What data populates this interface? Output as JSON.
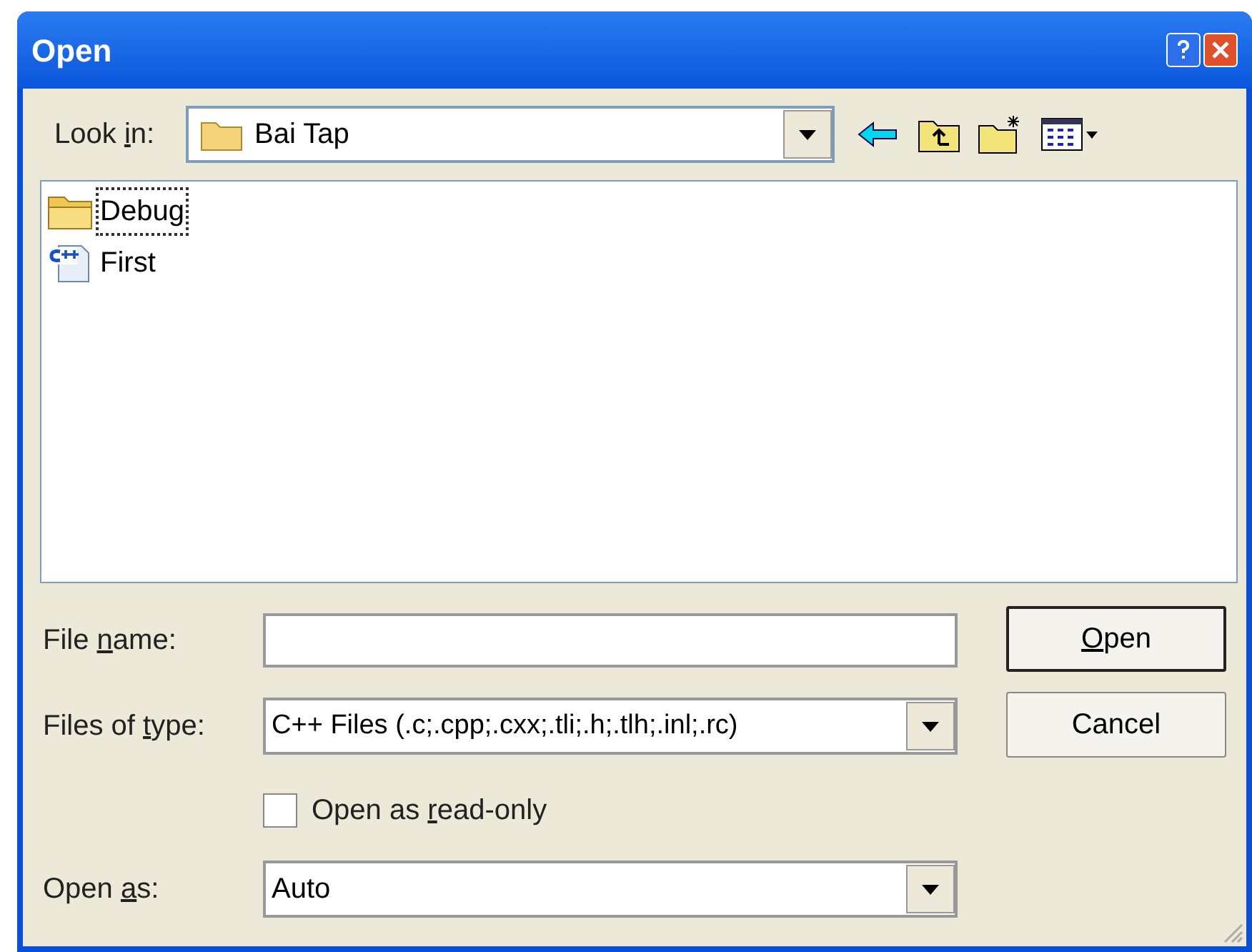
{
  "window": {
    "title": "Open"
  },
  "look_in": {
    "label": {
      "before": "Look ",
      "key": "i",
      "after": "n:"
    },
    "value": "Bai Tap"
  },
  "files": [
    {
      "name": "Debug",
      "kind": "folder",
      "selected": true
    },
    {
      "name": "First",
      "kind": "cpp",
      "selected": false
    }
  ],
  "file_name": {
    "label": {
      "before": "File ",
      "key": "n",
      "after": "ame:"
    }
  },
  "files_of_type": {
    "label": {
      "before": "Files of ",
      "key": "t",
      "after": "ype:"
    },
    "value": "C++ Files (.c;.cpp;.cxx;.tli;.h;.tlh;.inl;.rc)"
  },
  "read_only": {
    "label": {
      "before": "Open as ",
      "key": "r",
      "after": "ead-only"
    },
    "checked": false
  },
  "open_as": {
    "label": {
      "before": "Open ",
      "key": "a",
      "after": "s:"
    },
    "value": "Auto"
  },
  "buttons": [
    {
      "label": {
        "key": "O",
        "after": "pen"
      },
      "default": true
    },
    {
      "label": {
        "before": "Cancel"
      },
      "default": false
    }
  ]
}
